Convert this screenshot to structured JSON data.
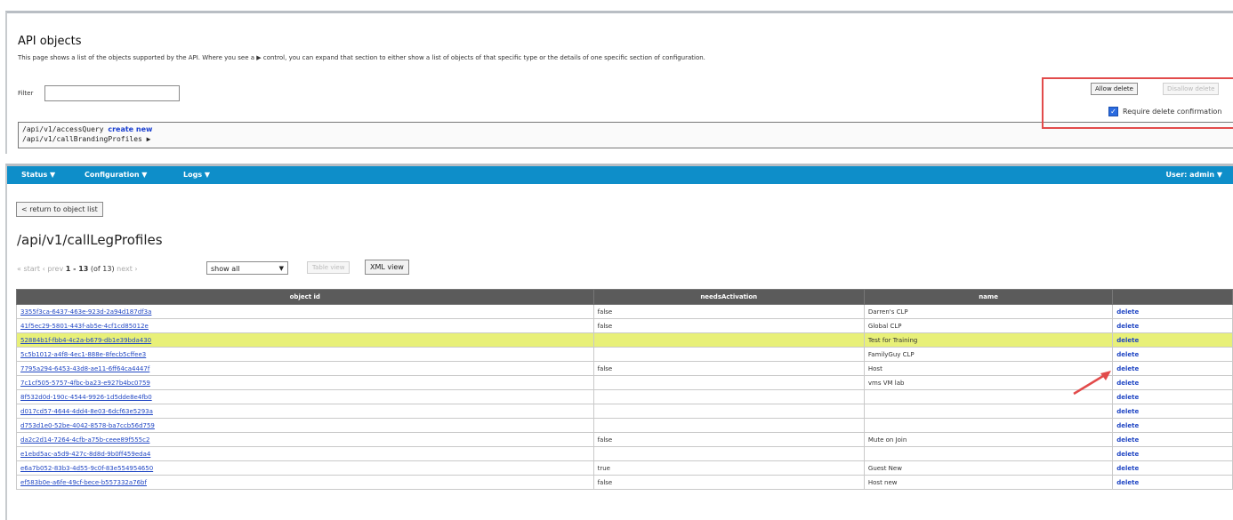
{
  "top": {
    "title": "API objects",
    "description": "This page shows a list of the objects supported by the API. Where you see a ▶ control, you can expand that section to either show a list of objects of that specific type or the details of one specific section of configuration.",
    "filter_label": "Filter",
    "filter_value": "",
    "paths": [
      {
        "path": "/api/v1/accessQuery",
        "link": "create new"
      },
      {
        "path": "/api/v1/callBrandingProfiles ▶",
        "link": ""
      }
    ],
    "allow_delete_label": "Allow delete",
    "disallow_delete_label": "Disallow delete",
    "require_confirm_label": "Require delete confirmation"
  },
  "nav": {
    "status": "Status ▼",
    "configuration": "Configuration ▼",
    "logs": "Logs ▼",
    "user": "User: admin ▼"
  },
  "object_page": {
    "return_label": "< return to object list",
    "title": "/api/v1/callLegProfiles",
    "pager_start": "« start",
    "pager_prev": "‹ prev",
    "pager_range": "1 - 13",
    "pager_count": "(of 13)",
    "pager_next": "next ›",
    "select_value": "show all",
    "table_view_label": "Table view",
    "xml_view_label": "XML view"
  },
  "table": {
    "headers": [
      "object id",
      "needsActivation",
      "name",
      ""
    ],
    "rows": [
      {
        "id": "3355f3ca-6437-463e-923d-2a94d187df3a",
        "needs": "false",
        "name": "Darren's CLP",
        "action": "delete"
      },
      {
        "id": "41f5ec29-5801-443f-ab5e-4cf1cd85012e",
        "needs": "false",
        "name": "Global CLP",
        "action": "delete"
      },
      {
        "id": "52884b1f-fbb4-4c2a-b679-db1e39bda430",
        "needs": "",
        "name": "Test for Training",
        "action": "delete"
      },
      {
        "id": "5c5b1012-a4f8-4ec1-888e-8fecb5cffee3",
        "needs": "",
        "name": "FamilyGuy CLP",
        "action": "delete"
      },
      {
        "id": "7795a294-6453-43d8-ae11-6ff64ca4447f",
        "needs": "false",
        "name": "Host",
        "action": "delete"
      },
      {
        "id": "7c1cf505-5757-4fbc-ba23-e927b4bc0759",
        "needs": "",
        "name": "vms VM lab",
        "action": "delete"
      },
      {
        "id": "8f532d0d-190c-4544-9926-1d5dde8e4fb0",
        "needs": "",
        "name": "",
        "action": "delete"
      },
      {
        "id": "d017cd57-4644-4dd4-8e03-6dcf63e5293a",
        "needs": "",
        "name": "",
        "action": "delete"
      },
      {
        "id": "d753d1e0-52be-4042-8578-ba7ccb56d759",
        "needs": "",
        "name": "",
        "action": "delete"
      },
      {
        "id": "da2c2d14-7264-4cfb-a75b-ceee89f555c2",
        "needs": "false",
        "name": "Mute on Join",
        "action": "delete"
      },
      {
        "id": "e1ebd5ac-a5d9-427c-8d8d-9b0ff459eda4",
        "needs": "",
        "name": "",
        "action": "delete"
      },
      {
        "id": "e6a7b052-83b3-4d55-9c0f-83e554954650",
        "needs": "true",
        "name": "Guest New",
        "action": "delete"
      },
      {
        "id": "ef583b0e-a6fe-49cf-bece-b557332a76bf",
        "needs": "false",
        "name": "Host new",
        "action": "delete"
      }
    ]
  },
  "colors": {
    "nav": "#0e8ec9",
    "highlight": "#e8f078",
    "annotation": "#e24b4b",
    "link": "#2147c4"
  }
}
